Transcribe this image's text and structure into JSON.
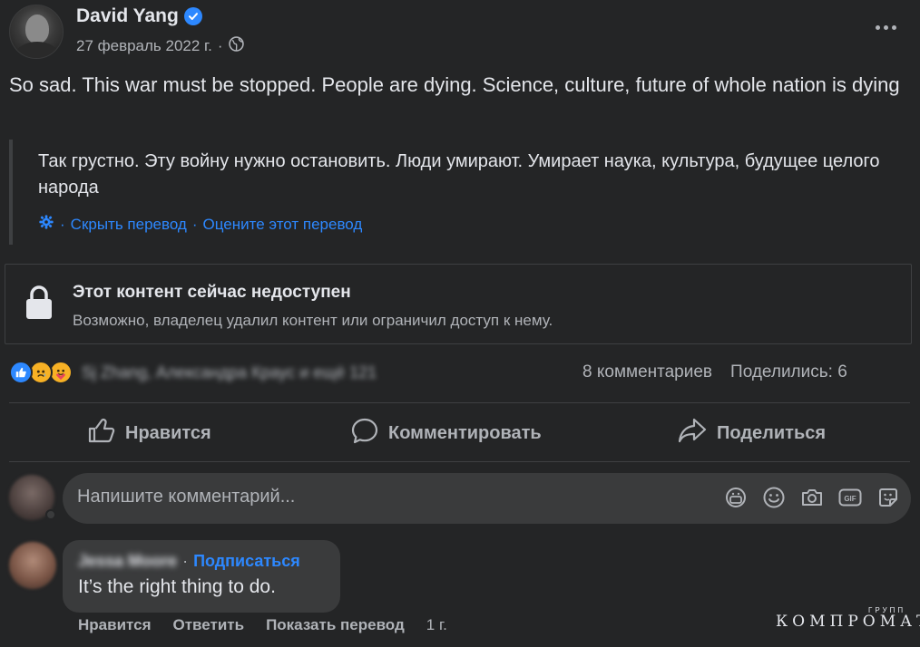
{
  "post": {
    "author": "David Yang",
    "date": "27 февраль 2022 г.",
    "separator": "·",
    "text": "So sad. This war must be stopped. People are dying. Science, culture, future of whole nation is dying",
    "translation": {
      "text": "Так грустно. Эту войну нужно остановить. Люди умирают. Умирает наука, культура, будущее целого народа",
      "hide_label": "Скрыть перевод",
      "rate_label": "Оцените этот перевод",
      "sep": "·"
    },
    "unavailable": {
      "title": "Этот контент сейчас недоступен",
      "subtitle": "Возможно, владелец удалил контент или ограничил доступ к нему."
    },
    "reactions": {
      "names": "Sj Zhang, Александра Краус и ещё 121",
      "comments": "8 комментариев",
      "shares": "Поделились: 6"
    },
    "actions": {
      "like": "Нравится",
      "comment": "Комментировать",
      "share": "Поделиться"
    }
  },
  "composer": {
    "placeholder": "Напишите комментарий..."
  },
  "comment": {
    "author": "Jessa Moore",
    "sep": "·",
    "follow": "Подписаться",
    "text": "It’s the right thing to do.",
    "like": "Нравится",
    "reply": "Ответить",
    "translate": "Показать перевод",
    "age": "1 г."
  },
  "watermark": {
    "main": "КОМПРОМАТ",
    "small": "ГРУПП"
  },
  "colors": {
    "background": "#242526",
    "surface": "#3a3b3c",
    "accent": "#2d88ff",
    "text": "#e4e6eb",
    "secondary": "#b0b3b8"
  }
}
